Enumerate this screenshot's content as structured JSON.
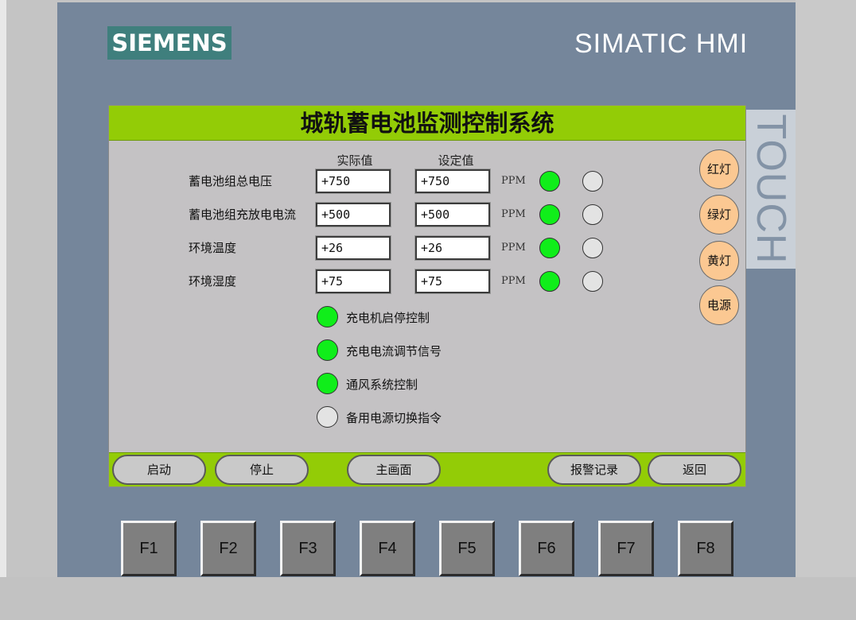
{
  "brand": {
    "logo": "SIEMENS",
    "product": "SIMATIC HMI",
    "touch": "TOUCH"
  },
  "screen": {
    "title": "城轨蓄电池监测控制系统",
    "headers": {
      "actual": "实际值",
      "setpoint": "设定值"
    },
    "rows": [
      {
        "label": "蓄电池组总电压",
        "actual": "+750",
        "setpoint": "+750",
        "unit": "PPM",
        "lamp_on": true,
        "lamp_off": false
      },
      {
        "label": "蓄电池组充放电电流",
        "actual": "+500",
        "setpoint": "+500",
        "unit": "PPM",
        "lamp_on": true,
        "lamp_off": false
      },
      {
        "label": "环境温度",
        "actual": "+26",
        "setpoint": "+26",
        "unit": "PPM",
        "lamp_on": true,
        "lamp_off": false
      },
      {
        "label": "环境湿度",
        "actual": "+75",
        "setpoint": "+75",
        "unit": "PPM",
        "lamp_on": true,
        "lamp_off": false
      }
    ],
    "controls": [
      {
        "label": "充电机启停控制",
        "on": true
      },
      {
        "label": "充电电流调节信号",
        "on": true
      },
      {
        "label": "通风系统控制",
        "on": true
      },
      {
        "label": "备用电源切换指令",
        "on": false
      }
    ],
    "side_buttons": [
      "红灯",
      "绿灯",
      "黄灯",
      "电源"
    ],
    "nav_buttons": [
      "启动",
      "停止",
      "主画面",
      "报警记录",
      "返回"
    ]
  },
  "function_keys": [
    "F1",
    "F2",
    "F3",
    "F4",
    "F5",
    "F6",
    "F7",
    "F8"
  ],
  "colors": {
    "title_bar": "#93cc06",
    "lamp_on": "#10ee1a",
    "lamp_off": "#e3e3e3",
    "side_button": "#fbc892",
    "bezel": "#75869b",
    "logo_bg": "#3f7f7d"
  }
}
